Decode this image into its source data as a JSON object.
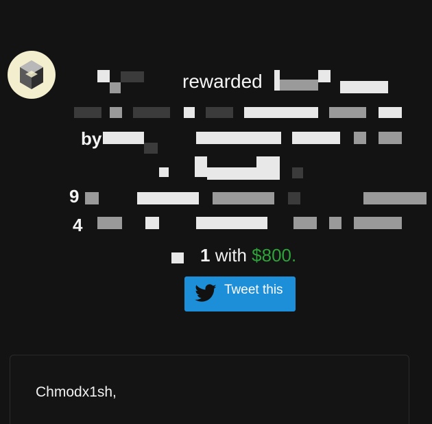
{
  "report": {
    "line1_text": "rewarded",
    "line3_prefix": "by",
    "line5_prefix": "9",
    "line6_prefix": "4",
    "award_number": "1",
    "award_with": " with ",
    "award_amount": "$800."
  },
  "tweet_button": {
    "label": "Tweet this",
    "icon": "twitter-bird-icon"
  },
  "comment": {
    "greeting": "Chmodx1sh,"
  },
  "colors": {
    "background": "#131313",
    "accent_blue": "#1d8fd9",
    "money_green": "#2ea33a"
  }
}
